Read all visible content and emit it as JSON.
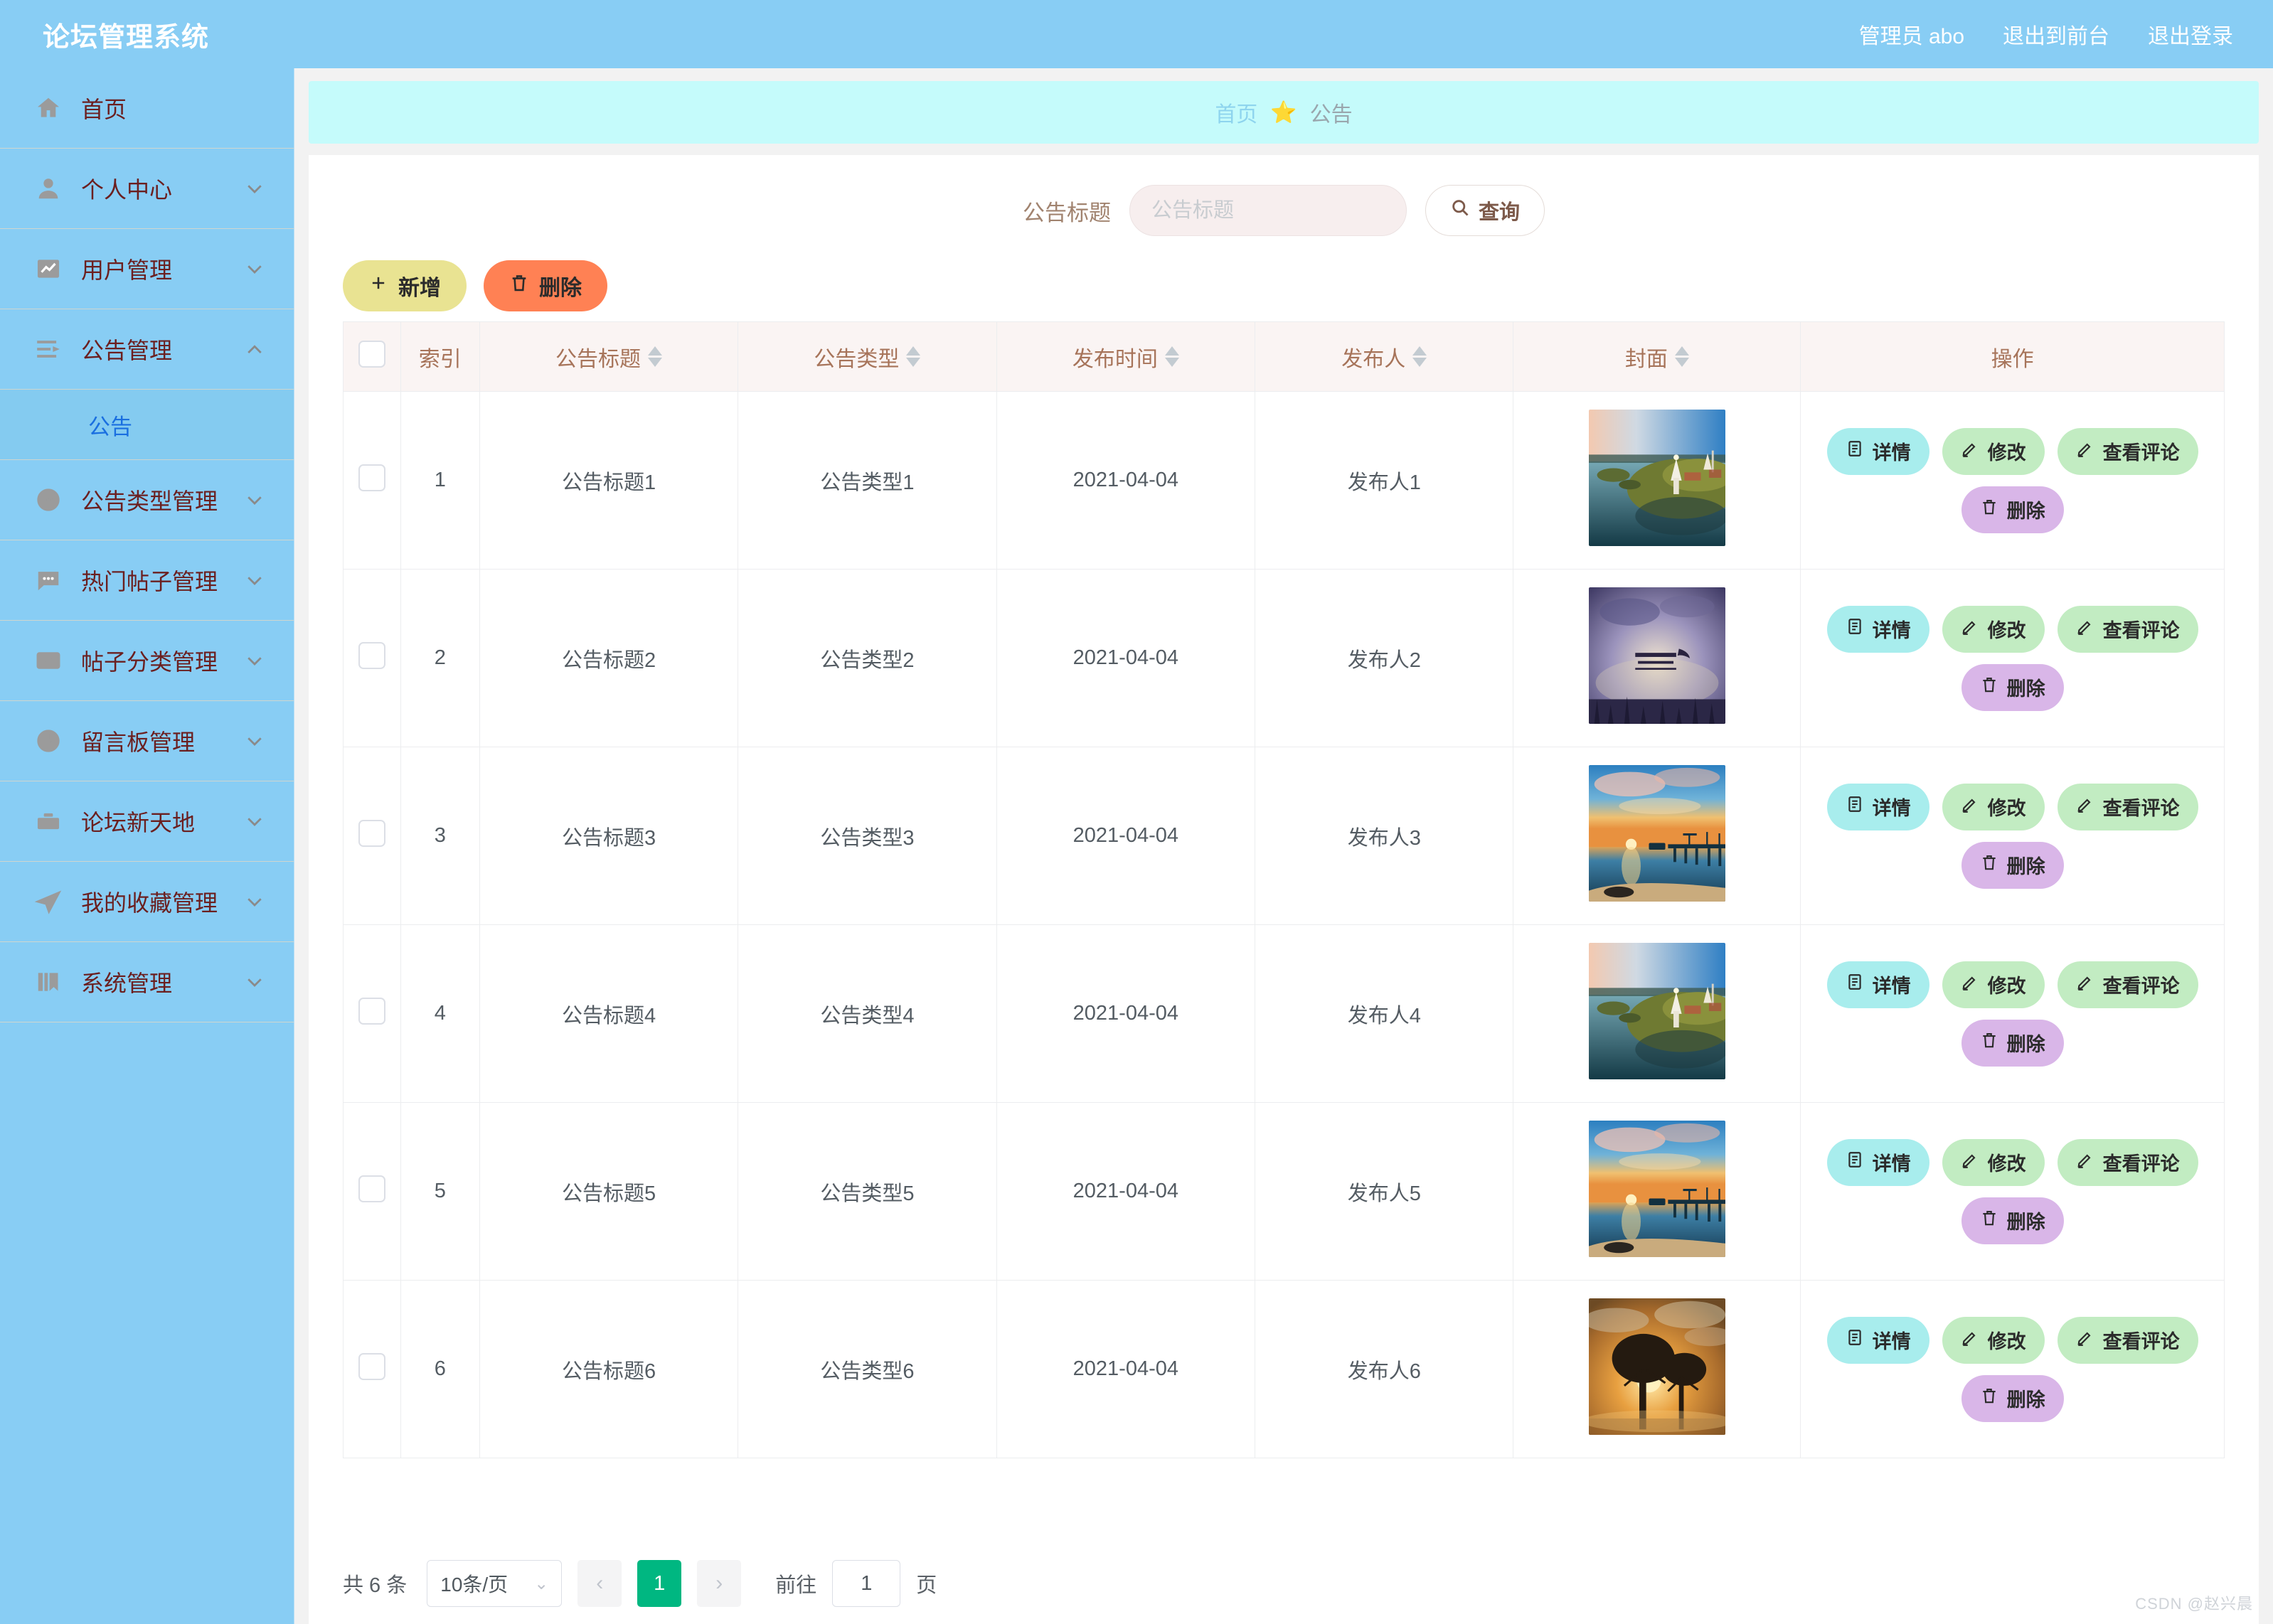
{
  "header": {
    "brand": "论坛管理系统",
    "links": [
      {
        "label": "管理员 abo",
        "name": "admin-user"
      },
      {
        "label": "退出到前台",
        "name": "exit-to-frontend"
      },
      {
        "label": "退出登录",
        "name": "logout"
      }
    ]
  },
  "sidebar": {
    "items": [
      {
        "label": "首页",
        "icon": "home-icon",
        "arrow": false
      },
      {
        "label": "个人中心",
        "icon": "user-icon",
        "arrow": "down"
      },
      {
        "label": "用户管理",
        "icon": "chart-icon",
        "arrow": "down"
      },
      {
        "label": "公告管理",
        "icon": "list-icon",
        "arrow": "up"
      }
    ],
    "active_sub": {
      "label": "公告"
    },
    "items_after": [
      {
        "label": "公告类型管理",
        "icon": "compass-icon",
        "arrow": "down"
      },
      {
        "label": "热门帖子管理",
        "icon": "comment-icon",
        "arrow": "down"
      },
      {
        "label": "帖子分类管理",
        "icon": "mail-icon",
        "arrow": "down"
      },
      {
        "label": "留言板管理",
        "icon": "clock-icon",
        "arrow": "down"
      },
      {
        "label": "论坛新天地",
        "icon": "briefcase-icon",
        "arrow": "down"
      },
      {
        "label": "我的收藏管理",
        "icon": "send-icon",
        "arrow": "down"
      },
      {
        "label": "系统管理",
        "icon": "book-icon",
        "arrow": "down"
      }
    ]
  },
  "breadcrumb": {
    "home": "首页",
    "star": "⭐",
    "current": "公告"
  },
  "search": {
    "label": "公告标题",
    "value": "",
    "placeholder": "公告标题",
    "query_button": "查询"
  },
  "toolbar": {
    "add_label": "新增",
    "delete_label": "删除"
  },
  "table": {
    "columns": [
      {
        "label": "",
        "sortable": false
      },
      {
        "label": "索引",
        "sortable": false
      },
      {
        "label": "公告标题",
        "sortable": true
      },
      {
        "label": "公告类型",
        "sortable": true
      },
      {
        "label": "发布时间",
        "sortable": true
      },
      {
        "label": "发布人",
        "sortable": true
      },
      {
        "label": "封面",
        "sortable": true
      },
      {
        "label": "操作",
        "sortable": false
      }
    ],
    "op_labels": {
      "detail": "详情",
      "edit": "修改",
      "comments": "查看评论",
      "delete": "删除"
    },
    "rows": [
      {
        "index": "1",
        "title": "公告标题1",
        "type": "公告类型1",
        "time": "2021-04-04",
        "publisher": "发布人1",
        "cover": "lake-town"
      },
      {
        "index": "2",
        "title": "公告标题2",
        "type": "公告类型2",
        "time": "2021-04-04",
        "publisher": "发布人2",
        "cover": "purple-sky"
      },
      {
        "index": "3",
        "title": "公告标题3",
        "type": "公告类型3",
        "time": "2021-04-04",
        "publisher": "发布人3",
        "cover": "sunset-pier"
      },
      {
        "index": "4",
        "title": "公告标题4",
        "type": "公告类型4",
        "time": "2021-04-04",
        "publisher": "发布人4",
        "cover": "lake-town"
      },
      {
        "index": "5",
        "title": "公告标题5",
        "type": "公告类型5",
        "time": "2021-04-04",
        "publisher": "发布人5",
        "cover": "sunset-pier"
      },
      {
        "index": "6",
        "title": "公告标题6",
        "type": "公告类型6",
        "time": "2021-04-04",
        "publisher": "发布人6",
        "cover": "sunset-tree"
      }
    ]
  },
  "pagination": {
    "total": "共 6 条",
    "page_size": "10条/页",
    "prev": "‹",
    "next": "›",
    "current_page": "1",
    "goto_label": "前往",
    "goto_value": "1",
    "page_unit": "页"
  },
  "watermark": "CSDN @赵兴晨",
  "colors": {
    "brand_blue": "#88cdf4",
    "breadcrumb_bg": "#c5fbfb",
    "add_btn": "#e9e392",
    "del_btn": "#ff8154",
    "detail_btn": "#a8eded",
    "edit_btn": "#c2ecc2",
    "delete_op_btn": "#d9b6e8",
    "page_active": "#00b781",
    "menu_text": "#6b1f1f",
    "th_text": "#a7745a"
  }
}
